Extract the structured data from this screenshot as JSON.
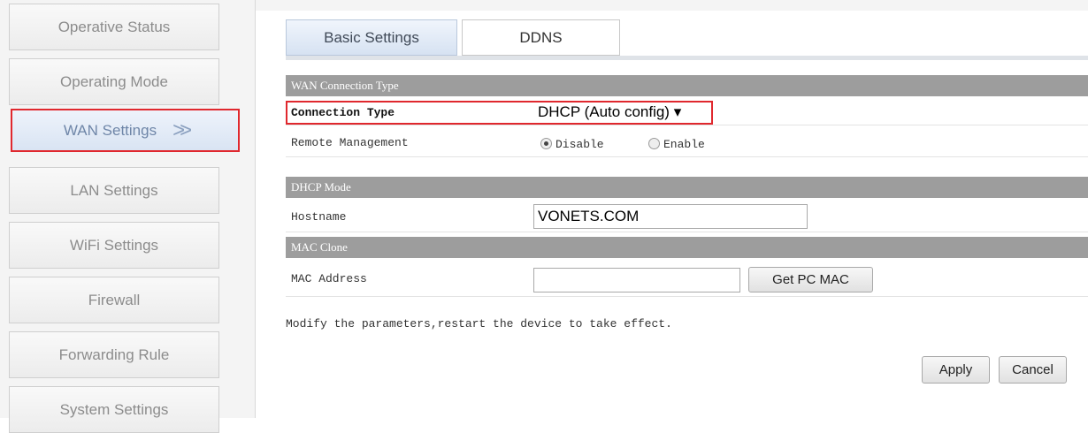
{
  "sidebar": {
    "items": [
      {
        "label": "Operative Status"
      },
      {
        "label": "Operating Mode"
      },
      {
        "label": "WAN Settings",
        "active": true
      },
      {
        "label": "LAN Settings"
      },
      {
        "label": "WiFi Settings"
      },
      {
        "label": "Firewall"
      },
      {
        "label": "Forwarding Rule"
      },
      {
        "label": "System Settings"
      }
    ],
    "active_arrow": ">>"
  },
  "tabs": [
    {
      "label": "Basic Settings",
      "active": true
    },
    {
      "label": "DDNS",
      "active": false
    }
  ],
  "sections": {
    "wan": {
      "header": "WAN Connection Type",
      "connection_type_label": "Connection Type",
      "connection_type_value": "DHCP (Auto config) ▾",
      "remote_management_label": "Remote Management",
      "remote_options": [
        "Disable",
        "Enable"
      ],
      "remote_selected": "Disable"
    },
    "dhcp": {
      "header": "DHCP Mode",
      "hostname_label": "Hostname",
      "hostname_value": "VONETS.COM"
    },
    "mac": {
      "header": "MAC Clone",
      "mac_label": "MAC Address",
      "mac_value": "",
      "get_pc_mac_label": "Get PC MAC"
    }
  },
  "note": "Modify the parameters,restart the device to take effect.",
  "actions": {
    "apply": "Apply",
    "cancel": "Cancel"
  },
  "colors": {
    "highlight_border": "#e0282e",
    "section_header_bg": "#9d9d9d"
  }
}
